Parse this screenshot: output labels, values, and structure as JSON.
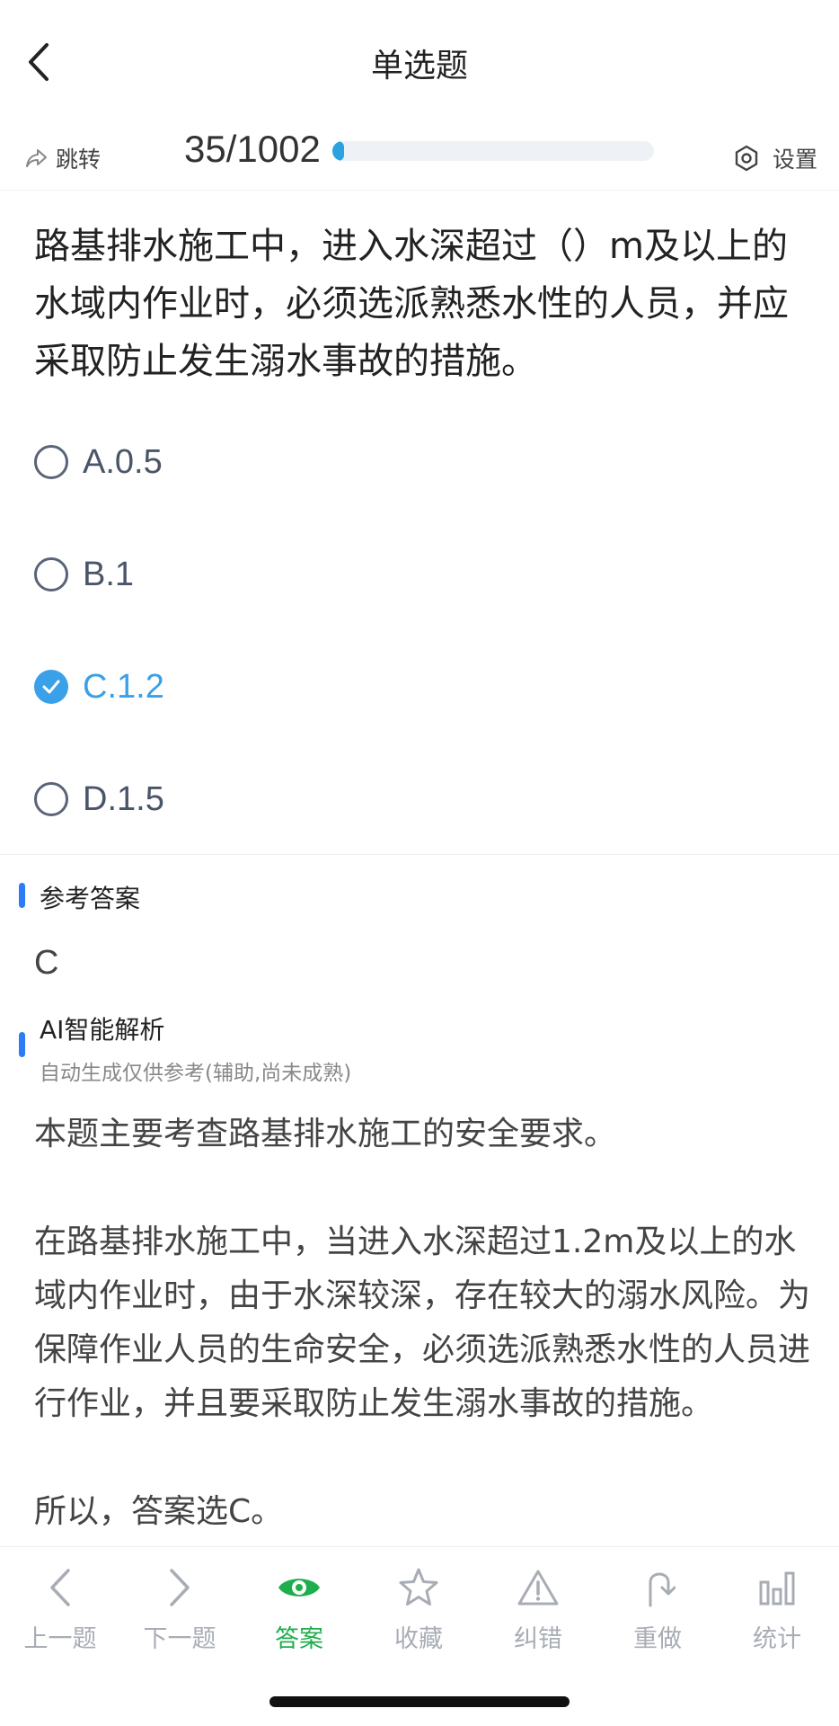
{
  "header": {
    "title": "单选题"
  },
  "toolbar": {
    "jump_label": "跳转",
    "progress_text": "35/1002",
    "progress_fraction": 0.035,
    "settings_label": "设置"
  },
  "question": {
    "text": "路基排水施工中，进入水深超过（）m及以上的水域内作业时，必须选派熟悉水性的人员，并应采取防止发生溺水事故的措施。"
  },
  "options": [
    {
      "label": "A.0.5",
      "selected": false
    },
    {
      "label": "B.1",
      "selected": false
    },
    {
      "label": "C.1.2",
      "selected": true
    },
    {
      "label": "D.1.5",
      "selected": false
    }
  ],
  "reference": {
    "title": "参考答案",
    "value": "C"
  },
  "ai": {
    "title": "AI智能解析",
    "subtitle": "自动生成仅供参考(辅助,尚未成熟)",
    "paragraphs": [
      "本题主要考查路基排水施工的安全要求。",
      "在路基排水施工中，当进入水深超过1.2m及以上的水域内作业时，由于水深较深，存在较大的溺水风险。为保障作业人员的生命安全，必须选派熟悉水性的人员进行作业，并且要采取防止发生溺水事故的措施。",
      "所以，答案选C。"
    ]
  },
  "tabs": [
    {
      "label": "上一题",
      "icon": "chevron-left-icon"
    },
    {
      "label": "下一题",
      "icon": "chevron-right-icon"
    },
    {
      "label": "答案",
      "icon": "eye-icon",
      "active": true
    },
    {
      "label": "收藏",
      "icon": "star-icon"
    },
    {
      "label": "纠错",
      "icon": "warning-icon"
    },
    {
      "label": "重做",
      "icon": "redo-icon"
    },
    {
      "label": "统计",
      "icon": "bar-chart-icon"
    }
  ],
  "colors": {
    "accent": "#3aa0e8",
    "active_tab": "#1fae4e",
    "progress": "#2aa3e0",
    "section_bar": "#2b7cf6"
  }
}
